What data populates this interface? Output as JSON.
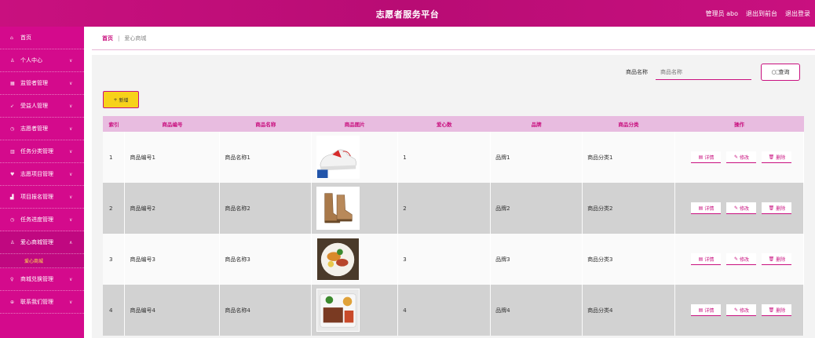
{
  "header": {
    "title": "志愿者服务平台",
    "user": "管理员 abo",
    "to_front": "退出到前台",
    "logout": "退出登录"
  },
  "sidebar": {
    "items": [
      {
        "label": "首页",
        "icon": "home-icon",
        "chevron": false
      },
      {
        "label": "个人中心",
        "icon": "user-icon",
        "chevron": true
      },
      {
        "label": "监管者管理",
        "icon": "grid-icon",
        "chevron": true
      },
      {
        "label": "受益人管理",
        "icon": "send-icon",
        "chevron": true
      },
      {
        "label": "志愿者管理",
        "icon": "clock-icon",
        "chevron": true
      },
      {
        "label": "任务分类管理",
        "icon": "bars-icon",
        "chevron": true
      },
      {
        "label": "志愿项目管理",
        "icon": "heart-icon",
        "chevron": true
      },
      {
        "label": "项目报名管理",
        "icon": "chart-icon",
        "chevron": true
      },
      {
        "label": "任务进度管理",
        "icon": "clock-icon",
        "chevron": true
      },
      {
        "label": "爱心商城管理",
        "icon": "user-icon",
        "chevron": true,
        "expanded": true
      },
      {
        "label": "商城兑换管理",
        "icon": "bulb-icon",
        "chevron": true
      },
      {
        "label": "联系我们管理",
        "icon": "globe-icon",
        "chevron": true
      }
    ],
    "sub_item": "爱心商城"
  },
  "breadcrumb": {
    "home": "首页",
    "separator": "|",
    "current": "爱心商城"
  },
  "search": {
    "label": "商品名称",
    "placeholder": "商品名称",
    "button": "查询"
  },
  "add_button": "新增",
  "table": {
    "headers": [
      "索引",
      "商品编号",
      "商品名称",
      "商品图片",
      "爱心数",
      "品牌",
      "商品分类",
      "操作"
    ],
    "rows": [
      {
        "idx": "1",
        "code": "商品编号1",
        "name": "商品名称1",
        "image": "sneaker-image",
        "hearts": "1",
        "brand": "品牌1",
        "category": "商品分类1"
      },
      {
        "idx": "2",
        "code": "商品编号2",
        "name": "商品名称2",
        "image": "boots-image",
        "hearts": "2",
        "brand": "品牌2",
        "category": "商品分类2"
      },
      {
        "idx": "3",
        "code": "商品编号3",
        "name": "商品名称3",
        "image": "food-plate-image",
        "hearts": "3",
        "brand": "品牌3",
        "category": "商品分类3"
      },
      {
        "idx": "4",
        "code": "商品编号4",
        "name": "商品名称4",
        "image": "meal-box-image",
        "hearts": "4",
        "brand": "品牌4",
        "category": "商品分类4"
      }
    ],
    "actions": {
      "detail": "详情",
      "edit": "修改",
      "delete": "删除"
    }
  },
  "colors": {
    "brand": "#c9107f",
    "sidebar": "#d40a8c",
    "active_sub": "#ffe14a",
    "add_button": "#f7d21a",
    "header_row": "#e8bce0"
  }
}
